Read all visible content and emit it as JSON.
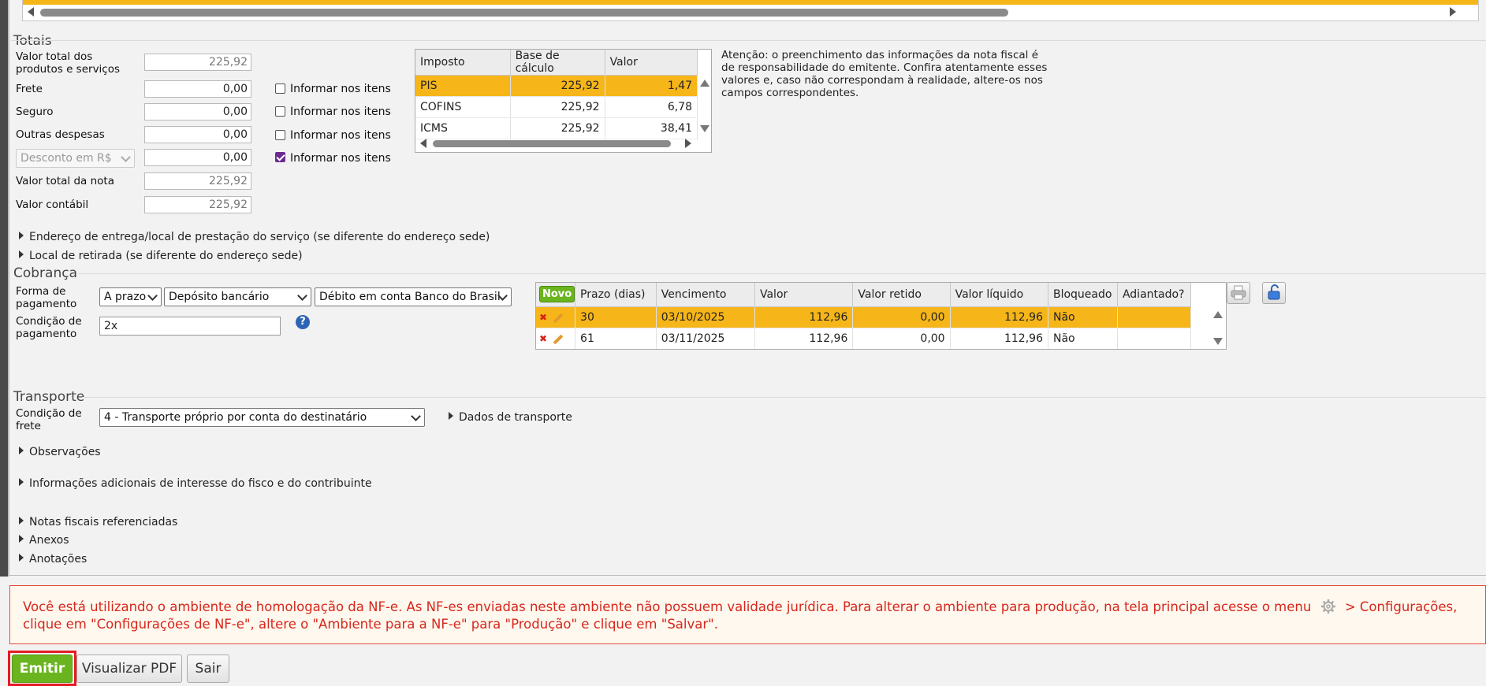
{
  "totais": {
    "title": "Totais",
    "rows": [
      {
        "label": "Valor total dos produtos e serviços",
        "value": "225,92"
      },
      {
        "label": "Frete",
        "value": "0,00",
        "check": "Informar nos itens",
        "checked": false
      },
      {
        "label": "Seguro",
        "value": "0,00",
        "check": "Informar nos itens",
        "checked": false
      },
      {
        "label": "Outras despesas",
        "value": "0,00",
        "check": "Informar nos itens",
        "checked": false
      },
      {
        "label": "Desconto em R$",
        "value": "0,00",
        "check": "Informar nos itens",
        "checked": true
      },
      {
        "label": "Valor total da nota",
        "value": "225,92"
      },
      {
        "label": "Valor contábil",
        "value": "225,92"
      }
    ]
  },
  "impostos": {
    "headers": [
      "Imposto",
      "Base de cálculo",
      "Valor"
    ],
    "rows": [
      {
        "imposto": "PIS",
        "base": "225,92",
        "valor": "1,47"
      },
      {
        "imposto": "COFINS",
        "base": "225,92",
        "valor": "6,78"
      },
      {
        "imposto": "ICMS",
        "base": "225,92",
        "valor": "38,41"
      }
    ]
  },
  "atencao": "Atenção: o preenchimento das informações da nota fiscal é de responsabilidade do emitente. Confira atentamente esses valores e, caso não correspondam à realidade, altere-os nos campos correspondentes.",
  "expanders_top": [
    "Endereço de entrega/local de prestação do serviço (se diferente do endereço sede)",
    "Local de retirada (se diferente do endereço sede)"
  ],
  "cobranca": {
    "title": "Cobrança",
    "forma_label": "Forma de pagamento",
    "forma_1": "A prazo",
    "forma_2": "Depósito bancário",
    "forma_3": "Débito em conta Banco do Brasil",
    "condicao_label": "Condição de pagamento",
    "condicao_value": "2x",
    "help": "?",
    "novo": "Novo",
    "headers": [
      "Prazo (dias)",
      "Vencimento",
      "Valor",
      "Valor retido",
      "Valor líquido",
      "Bloqueado",
      "Adiantado?"
    ],
    "parcelas": [
      {
        "prazo": "30",
        "vencimento": "03/10/2025",
        "valor": "112,96",
        "retido": "0,00",
        "liquido": "112,96",
        "bloqueado": "Não",
        "adiantado": ""
      },
      {
        "prazo": "61",
        "vencimento": "03/11/2025",
        "valor": "112,96",
        "retido": "0,00",
        "liquido": "112,96",
        "bloqueado": "Não",
        "adiantado": ""
      }
    ]
  },
  "transporte": {
    "title": "Transporte",
    "condicao_label": "Condição de frete",
    "condicao_value": "4 - Transporte próprio por conta do destinatário",
    "dados": "Dados de transporte"
  },
  "expanders_bottom": [
    "Observações",
    "Informações adicionais de interesse do fisco e do contribuinte",
    "Notas fiscais referenciadas",
    "Anexos",
    "Anotações"
  ],
  "banner": {
    "text_1": "Você está utilizando o ambiente de homologação da NF-e. As NF-es enviadas neste ambiente não possuem validade jurídica. Para alterar o ambiente para produção, na tela principal acesse o menu",
    "text_2": "> Configurações, clique em \"Configurações de NF-e\", altere o \"Ambiente para a NF-e\" para \"Produção\" e clique em \"Salvar\"."
  },
  "actions": {
    "emitir": "Emitir",
    "pdf": "Visualizar PDF",
    "sair": "Sair"
  },
  "colors": {
    "highlight": "#f6b619",
    "primary": "#6ab51f",
    "warning": "#d6271d"
  }
}
